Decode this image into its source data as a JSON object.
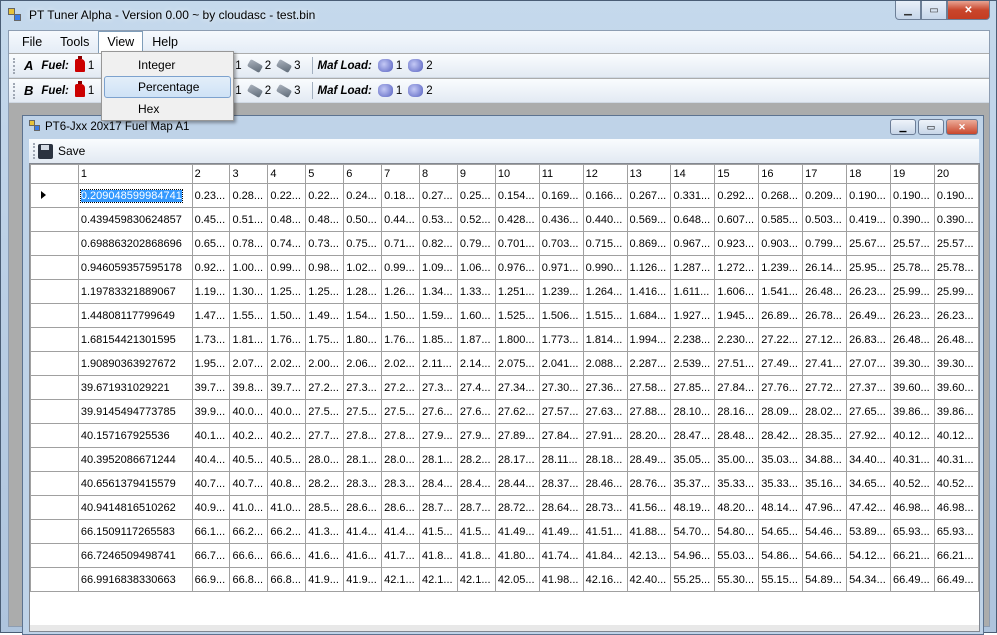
{
  "window": {
    "title": "PT Tuner Alpha - Version 0.00 ~ by cloudasc - test.bin"
  },
  "menu": [
    "File",
    "Tools",
    "View",
    "Help"
  ],
  "view_menu": {
    "items": [
      "Integer",
      "Percentage",
      "Hex"
    ],
    "highlighted": "Percentage"
  },
  "toolbars": [
    {
      "row": "A",
      "fuel_label": "Fuel:",
      "fuel_items": [
        "1"
      ],
      "inj_items": [
        "1",
        "2",
        "3"
      ],
      "maf_label": "Maf Load:",
      "maf_items": [
        "1",
        "2"
      ]
    },
    {
      "row": "B",
      "fuel_label": "Fuel:",
      "fuel_items": [
        "1"
      ],
      "inj_items": [
        "1",
        "2",
        "3"
      ],
      "maf_label": "Maf Load:",
      "maf_items": [
        "1",
        "2"
      ]
    }
  ],
  "child": {
    "title": "PT6-Jxx 20x17 Fuel Map A1",
    "save_label": "Save"
  },
  "grid": {
    "columns": [
      "1",
      "2",
      "3",
      "4",
      "5",
      "6",
      "7",
      "8",
      "9",
      "10",
      "11",
      "12",
      "13",
      "14",
      "15",
      "16",
      "17",
      "18",
      "19",
      "20"
    ],
    "rows": [
      [
        "0.209048599984741",
        "0.23...",
        "0.28...",
        "0.22...",
        "0.22...",
        "0.24...",
        "0.18...",
        "0.27...",
        "0.25...",
        "0.154...",
        "0.169...",
        "0.166...",
        "0.267...",
        "0.331...",
        "0.292...",
        "0.268...",
        "0.209...",
        "0.190...",
        "0.190...",
        "0.190..."
      ],
      [
        "0.439459830624857",
        "0.45...",
        "0.51...",
        "0.48...",
        "0.48...",
        "0.50...",
        "0.44...",
        "0.53...",
        "0.52...",
        "0.428...",
        "0.436...",
        "0.440...",
        "0.569...",
        "0.648...",
        "0.607...",
        "0.585...",
        "0.503...",
        "0.419...",
        "0.390...",
        "0.390..."
      ],
      [
        "0.698863202868696",
        "0.65...",
        "0.78...",
        "0.74...",
        "0.73...",
        "0.75...",
        "0.71...",
        "0.82...",
        "0.79...",
        "0.701...",
        "0.703...",
        "0.715...",
        "0.869...",
        "0.967...",
        "0.923...",
        "0.903...",
        "0.799...",
        "25.67...",
        "25.57...",
        "25.57..."
      ],
      [
        "0.946059357595178",
        "0.92...",
        "1.00...",
        "0.99...",
        "0.98...",
        "1.02...",
        "0.99...",
        "1.09...",
        "1.06...",
        "0.976...",
        "0.971...",
        "0.990...",
        "1.126...",
        "1.287...",
        "1.272...",
        "1.239...",
        "26.14...",
        "25.95...",
        "25.78...",
        "25.78..."
      ],
      [
        "1.19783321889067",
        "1.19...",
        "1.30...",
        "1.25...",
        "1.25...",
        "1.28...",
        "1.26...",
        "1.34...",
        "1.33...",
        "1.251...",
        "1.239...",
        "1.264...",
        "1.416...",
        "1.611...",
        "1.606...",
        "1.541...",
        "26.48...",
        "26.23...",
        "25.99...",
        "25.99..."
      ],
      [
        "1.44808117799649",
        "1.47...",
        "1.55...",
        "1.50...",
        "1.49...",
        "1.54...",
        "1.50...",
        "1.59...",
        "1.60...",
        "1.525...",
        "1.506...",
        "1.515...",
        "1.684...",
        "1.927...",
        "1.945...",
        "26.89...",
        "26.78...",
        "26.49...",
        "26.23...",
        "26.23..."
      ],
      [
        "1.68154421301595",
        "1.73...",
        "1.81...",
        "1.76...",
        "1.75...",
        "1.80...",
        "1.76...",
        "1.85...",
        "1.87...",
        "1.800...",
        "1.773...",
        "1.814...",
        "1.994...",
        "2.238...",
        "2.230...",
        "27.22...",
        "27.12...",
        "26.83...",
        "26.48...",
        "26.48..."
      ],
      [
        "1.90890363927672",
        "1.95...",
        "2.07...",
        "2.02...",
        "2.00...",
        "2.06...",
        "2.02...",
        "2.11...",
        "2.14...",
        "2.075...",
        "2.041...",
        "2.088...",
        "2.287...",
        "2.539...",
        "27.51...",
        "27.49...",
        "27.41...",
        "27.07...",
        "39.30...",
        "39.30..."
      ],
      [
        "39.671931029221",
        "39.7...",
        "39.8...",
        "39.7...",
        "27.2...",
        "27.3...",
        "27.2...",
        "27.3...",
        "27.4...",
        "27.34...",
        "27.30...",
        "27.36...",
        "27.58...",
        "27.85...",
        "27.84...",
        "27.76...",
        "27.72...",
        "27.37...",
        "39.60...",
        "39.60..."
      ],
      [
        "39.9145494773785",
        "39.9...",
        "40.0...",
        "40.0...",
        "27.5...",
        "27.5...",
        "27.5...",
        "27.6...",
        "27.6...",
        "27.62...",
        "27.57...",
        "27.63...",
        "27.88...",
        "28.10...",
        "28.16...",
        "28.09...",
        "28.02...",
        "27.65...",
        "39.86...",
        "39.86..."
      ],
      [
        "40.157167925536",
        "40.1...",
        "40.2...",
        "40.2...",
        "27.7...",
        "27.8...",
        "27.8...",
        "27.9...",
        "27.9...",
        "27.89...",
        "27.84...",
        "27.91...",
        "28.20...",
        "28.47...",
        "28.48...",
        "28.42...",
        "28.35...",
        "27.92...",
        "40.12...",
        "40.12..."
      ],
      [
        "40.3952086671244",
        "40.4...",
        "40.5...",
        "40.5...",
        "28.0...",
        "28.1...",
        "28.0...",
        "28.1...",
        "28.2...",
        "28.17...",
        "28.11...",
        "28.18...",
        "28.49...",
        "35.05...",
        "35.00...",
        "35.03...",
        "34.88...",
        "34.40...",
        "40.31...",
        "40.31..."
      ],
      [
        "40.6561379415579",
        "40.7...",
        "40.7...",
        "40.8...",
        "28.2...",
        "28.3...",
        "28.3...",
        "28.4...",
        "28.4...",
        "28.44...",
        "28.37...",
        "28.46...",
        "28.76...",
        "35.37...",
        "35.33...",
        "35.33...",
        "35.16...",
        "34.65...",
        "40.52...",
        "40.52..."
      ],
      [
        "40.9414816510262",
        "40.9...",
        "41.0...",
        "41.0...",
        "28.5...",
        "28.6...",
        "28.6...",
        "28.7...",
        "28.7...",
        "28.72...",
        "28.64...",
        "28.73...",
        "41.56...",
        "48.19...",
        "48.20...",
        "48.14...",
        "47.96...",
        "47.42...",
        "46.98...",
        "46.98..."
      ],
      [
        "66.1509117265583",
        "66.1...",
        "66.2...",
        "66.2...",
        "41.3...",
        "41.4...",
        "41.4...",
        "41.5...",
        "41.5...",
        "41.49...",
        "41.49...",
        "41.51...",
        "41.88...",
        "54.70...",
        "54.80...",
        "54.65...",
        "54.46...",
        "53.89...",
        "65.93...",
        "65.93..."
      ],
      [
        "66.7246509498741",
        "66.7...",
        "66.6...",
        "66.6...",
        "41.6...",
        "41.6...",
        "41.7...",
        "41.8...",
        "41.8...",
        "41.80...",
        "41.74...",
        "41.84...",
        "42.13...",
        "54.96...",
        "55.03...",
        "54.86...",
        "54.66...",
        "54.12...",
        "66.21...",
        "66.21..."
      ],
      [
        "66.9916838330663",
        "66.9...",
        "66.8...",
        "66.8...",
        "41.9...",
        "41.9...",
        "42.1...",
        "42.1...",
        "42.1...",
        "42.05...",
        "41.98...",
        "42.16...",
        "42.40...",
        "55.25...",
        "55.30...",
        "55.15...",
        "54.89...",
        "54.34...",
        "66.49...",
        "66.49..."
      ]
    ]
  }
}
